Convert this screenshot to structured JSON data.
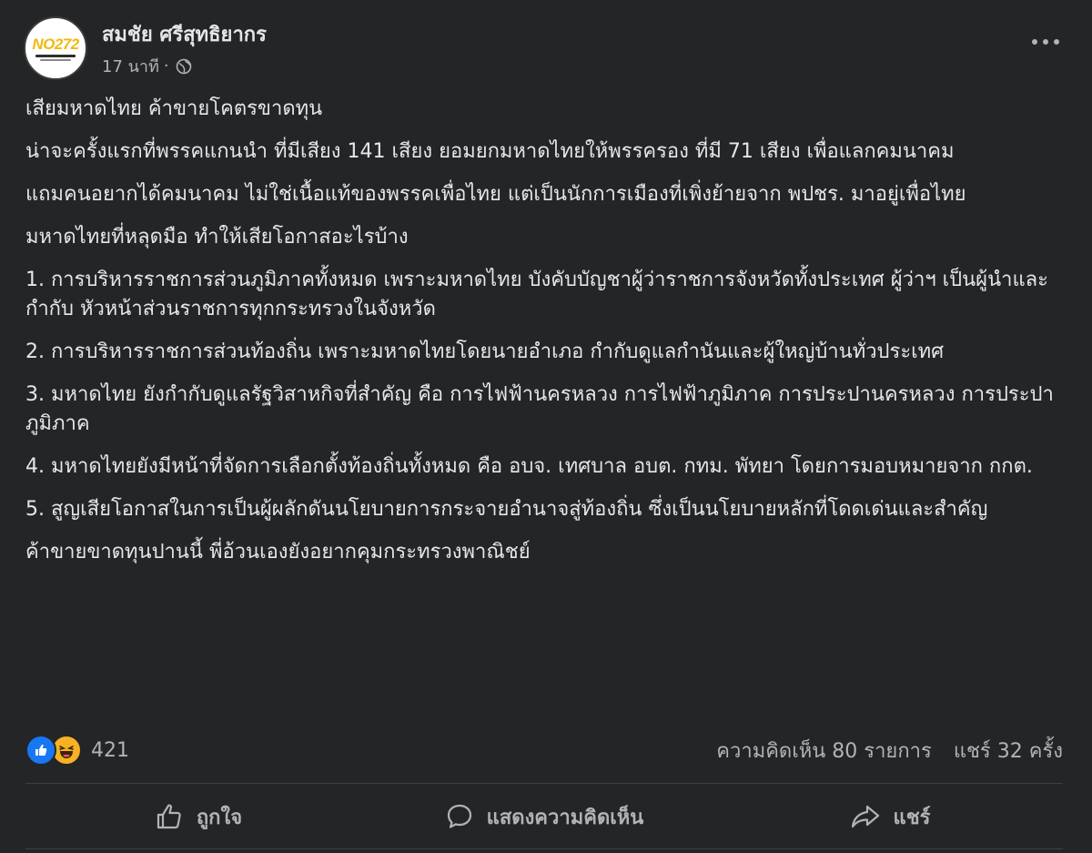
{
  "post": {
    "author": "สมชัย ศรีสุทธิยากร",
    "avatar_text": "NO272",
    "time": "17 นาที",
    "separator": "·",
    "audience_icon": "globe-icon",
    "more_icon": "more-options-icon",
    "paragraphs": [
      "เสียมหาดไทย ค้าขายโคตรขาดทุน",
      "น่าจะครั้งแรกที่พรรคแกนนำ ที่มีเสียง 141 เสียง ยอมยกมหาดไทยให้พรรครอง ที่มี 71 เสียง เพื่อแลกคมนาคม",
      "แถมคนอยากได้คมนาคม ไม่ใช่เนื้อแท้ของพรรคเพื่อไทย แต่เป็นนักการเมืองที่เพิ่งย้ายจาก พปชร. มาอยู่เพื่อไทย",
      "มหาดไทยที่หลุดมือ ทำให้เสียโอกาสอะไรบ้าง",
      "1. การบริหารราชการส่วนภูมิภาคทั้งหมด  เพราะมหาดไทย บังคับบัญชาผู้ว่าราชการจังหวัดทั้งประเทศ ผู้ว่าฯ เป็นผู้นำและกำกับ หัวหน้าส่วนราชการทุกกระทรวงในจังหวัด",
      "2. การบริหารราชการส่วนท้องถิ่น เพราะมหาดไทยโดยนายอำเภอ กำกับดูแลกำนันและผู้ใหญ่บ้านทั่วประเทศ",
      "3. มหาดไทย ยังกำกับดูแลรัฐวิสาหกิจที่สำคัญ คือ  การไฟฟ้านครหลวง การไฟฟ้าภูมิภาค  การประปานครหลวง การประปาภูมิภาค",
      "4. มหาดไทยยังมีหน้าที่จัดการเลือกตั้งท้องถิ่นทั้งหมด คือ อบจ. เทศบาล อบต.  กทม.  พัทยา โดยการมอบหมายจาก กกต.",
      "5. สูญเสียโอกาสในการเป็นผู้ผลักดันนโยบายการกระจายอำนาจสู่ท้องถิ่น ซึ่งเป็นนโยบายหลักที่โดดเด่นและสำคัญ",
      "ค้าขายขาดทุนปานนี้  พี่อ้วนเองยังอยากคุมกระทรวงพาณิชย์"
    ]
  },
  "stats": {
    "reaction_icons": [
      "like-icon",
      "haha-icon"
    ],
    "reaction_count": "421",
    "comments": "ความคิดเห็น 80 รายการ",
    "shares": "แชร์ 32 ครั้ง"
  },
  "actions": {
    "like": "ถูกใจ",
    "comment": "แสดงความคิดเห็น",
    "share": "แชร์"
  },
  "colors": {
    "background": "#242526",
    "text": "#e4e6eb",
    "secondary_text": "#b0b3b8",
    "like_blue": "#1877f2",
    "haha_yellow": "#f7b125"
  }
}
